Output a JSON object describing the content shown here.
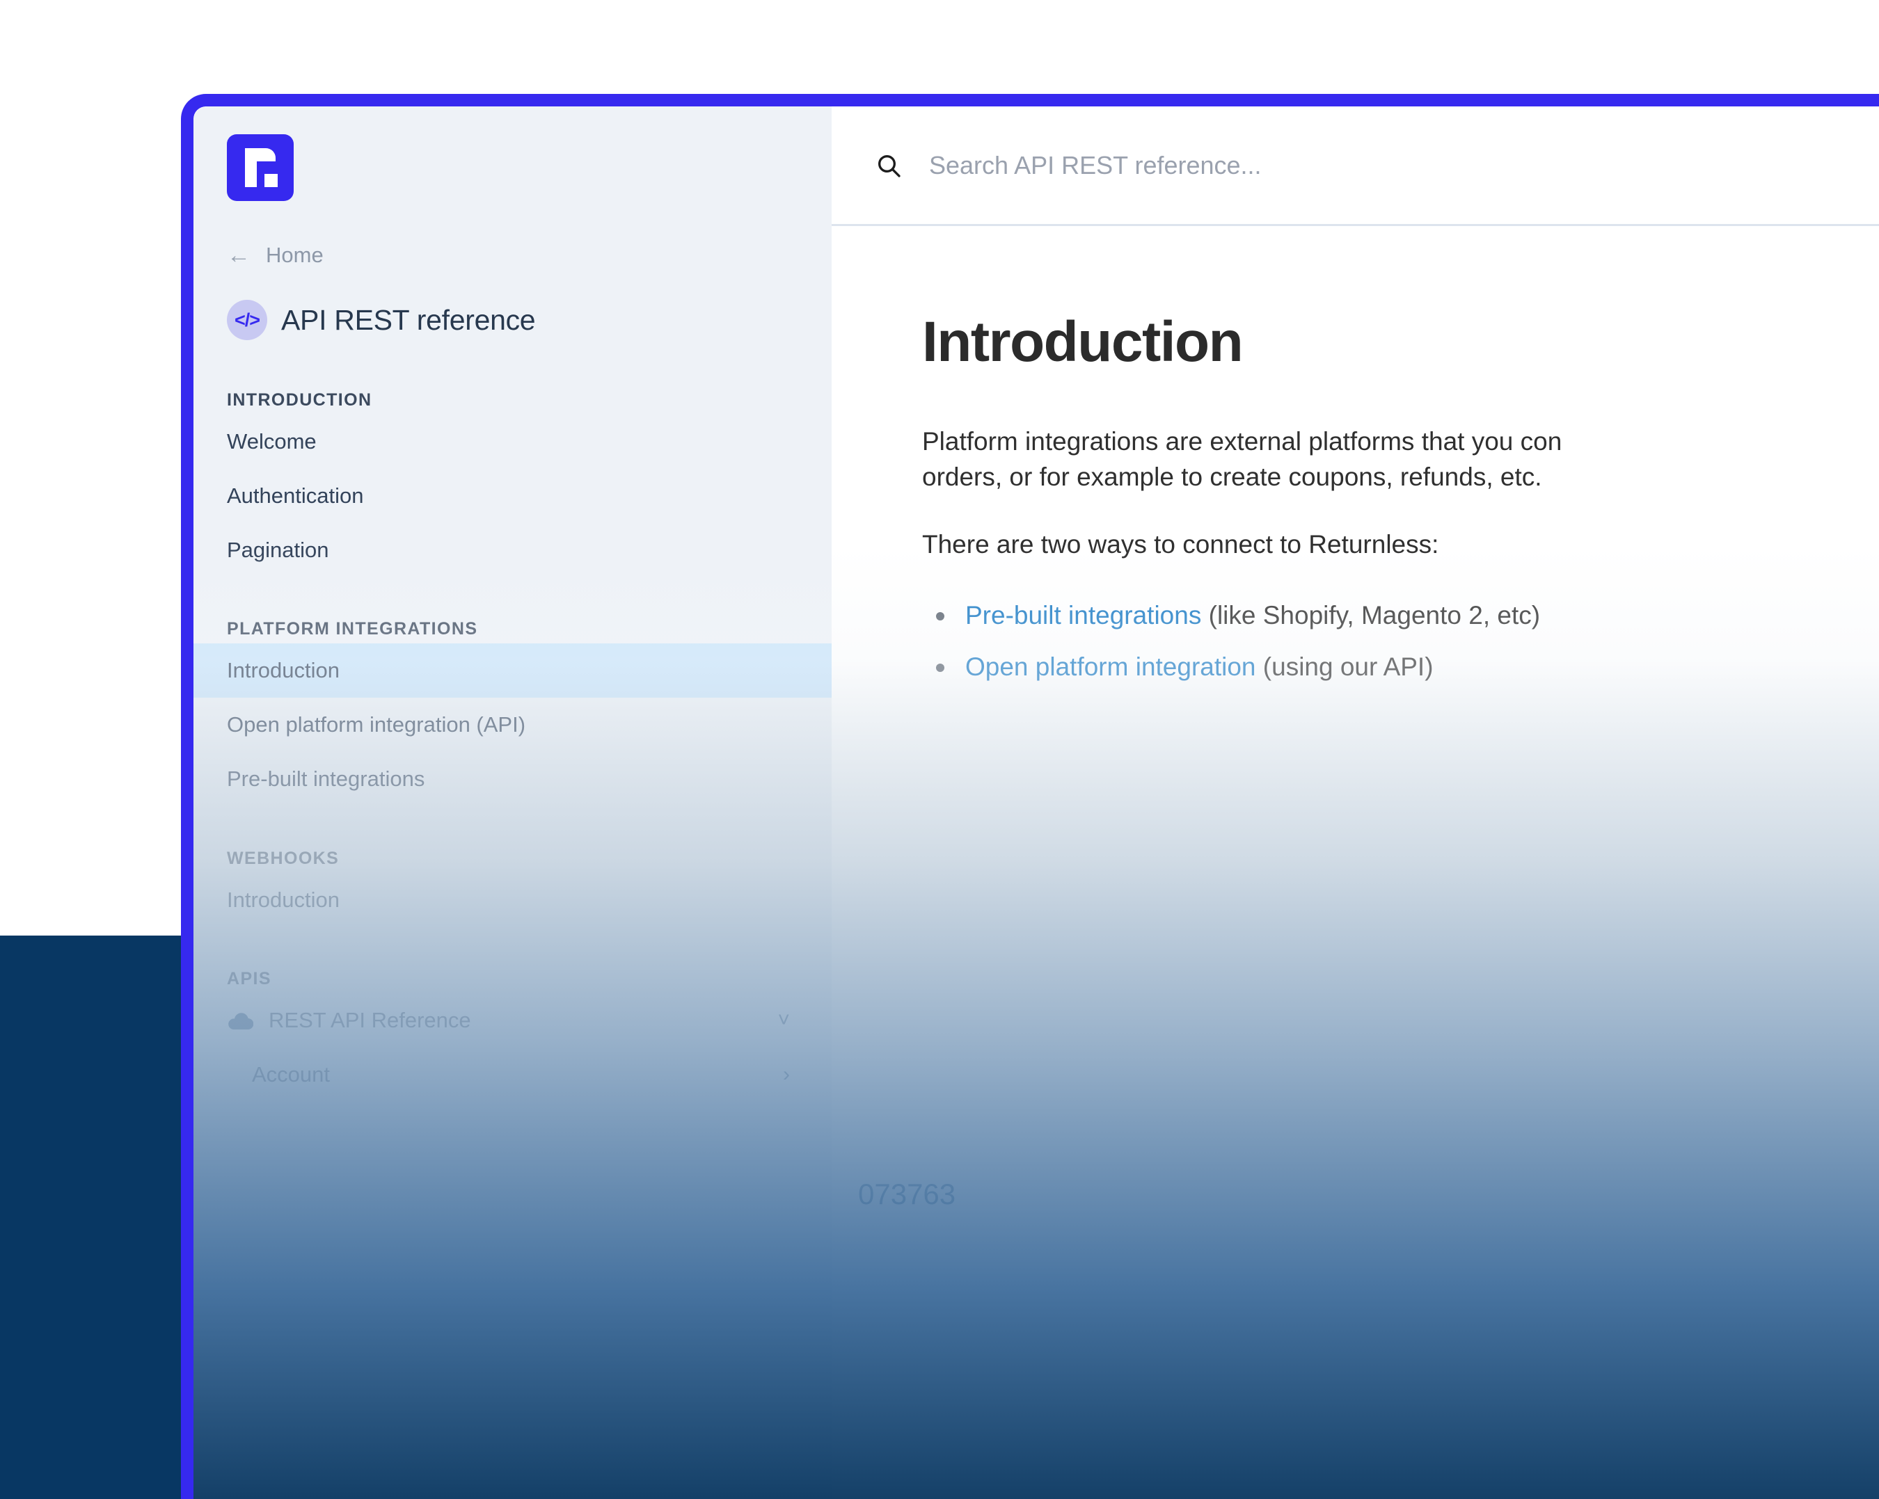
{
  "colors": {
    "brand_blue": "#3629ef",
    "navy": "#083763",
    "active_item_bg": "#c8e4fb",
    "link_blue": "#1779c4",
    "sidebar_bg": "#eef2f7"
  },
  "sidebar": {
    "logo_alt": "returnless-logo",
    "back_link": "Home",
    "back_icon": "arrow-left-icon",
    "reference_icon": "code-brackets-icon",
    "reference_title": "API REST reference",
    "groups": [
      {
        "label": "INTRODUCTION",
        "items": [
          {
            "label": "Welcome",
            "active": false
          },
          {
            "label": "Authentication",
            "active": false
          },
          {
            "label": "Pagination",
            "active": false
          }
        ]
      },
      {
        "label": "PLATFORM INTEGRATIONS",
        "items": [
          {
            "label": "Introduction",
            "active": true
          },
          {
            "label": "Open platform integration (API)",
            "active": false
          },
          {
            "label": "Pre-built integrations",
            "active": false
          }
        ]
      },
      {
        "label": "WEBHOOKS",
        "items": [
          {
            "label": "Introduction",
            "active": false
          }
        ]
      },
      {
        "label": "APIS",
        "items": [
          {
            "label": "REST API Reference",
            "active": false,
            "icon": "cloud-icon",
            "chevron": "chevron-down-icon"
          },
          {
            "label": "Account",
            "active": false,
            "indented": true,
            "chevron": "chevron-right-icon"
          }
        ]
      }
    ]
  },
  "search": {
    "icon": "search-icon",
    "placeholder": "Search API REST reference...",
    "value": ""
  },
  "main": {
    "title": "Introduction",
    "paragraph_1_line_1": "Platform integrations are external platforms that you con",
    "paragraph_1_line_2": "orders, or for example to create coupons, refunds, etc.",
    "paragraph_2": "There are two ways to connect to Returnless:",
    "bullets": [
      {
        "link": "Pre-built integrations",
        "rest": " (like Shopify, Magento 2, etc)"
      },
      {
        "link": "Open platform integration",
        "rest": " (using our API)"
      }
    ],
    "code_number": "073763"
  }
}
